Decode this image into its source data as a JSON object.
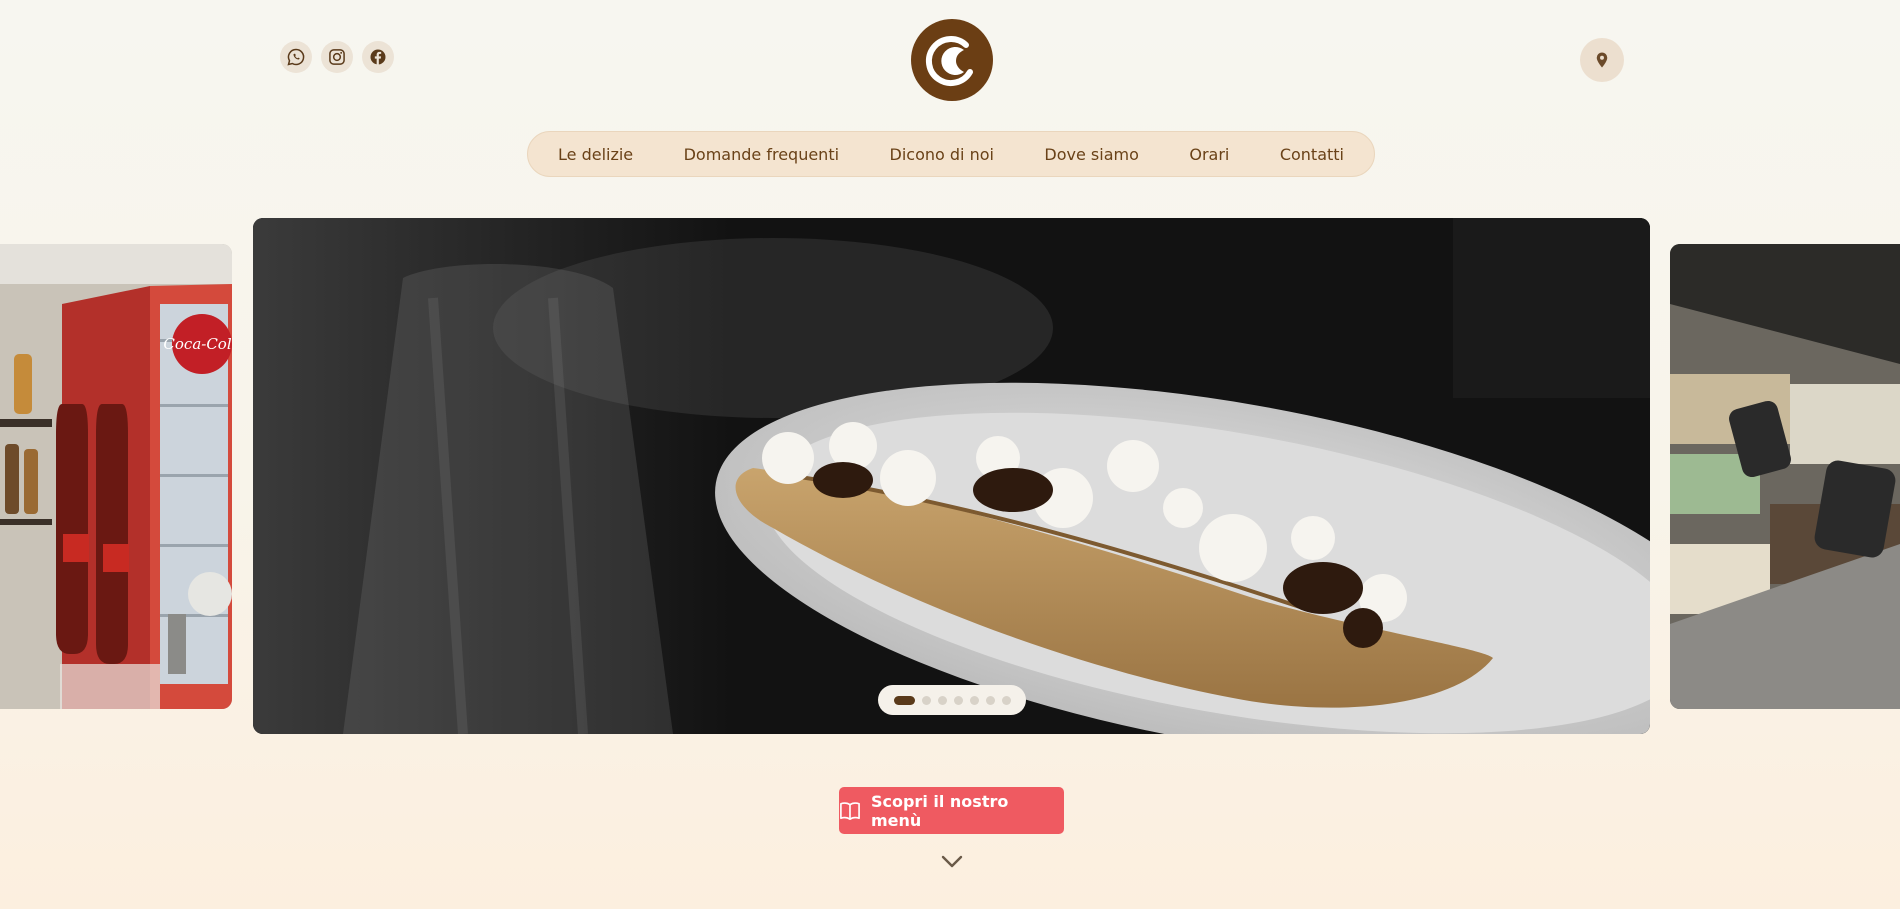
{
  "header": {
    "socials": [
      {
        "name": "whatsapp",
        "icon": "whatsapp-icon"
      },
      {
        "name": "instagram",
        "icon": "instagram-icon"
      },
      {
        "name": "facebook",
        "icon": "facebook-icon"
      }
    ],
    "logo_icon": "crepe-logo-icon",
    "location_icon": "map-pin-icon"
  },
  "nav": {
    "items": [
      {
        "label": "Le delizie"
      },
      {
        "label": "Domande frequenti"
      },
      {
        "label": "Dicono di noi"
      },
      {
        "label": "Dove siamo"
      },
      {
        "label": "Orari"
      },
      {
        "label": "Contatti"
      }
    ]
  },
  "carousel": {
    "slide_count": 7,
    "active_index": 0,
    "slides": [
      {
        "subject": "crepe with chocolate, whipped cream and hazelnuts"
      },
      {
        "subject": "gelato display"
      },
      {
        "subject": "bar with Coca-Cola fridge"
      }
    ],
    "fridge_brand": "Coca-Cola"
  },
  "cta": {
    "label": "Scopri il nostro menù",
    "icon": "book-open-icon"
  },
  "colors": {
    "brand_brown": "#6b3e14",
    "cta_red": "#ef5a61",
    "nav_bg": "#f4e4d0"
  }
}
